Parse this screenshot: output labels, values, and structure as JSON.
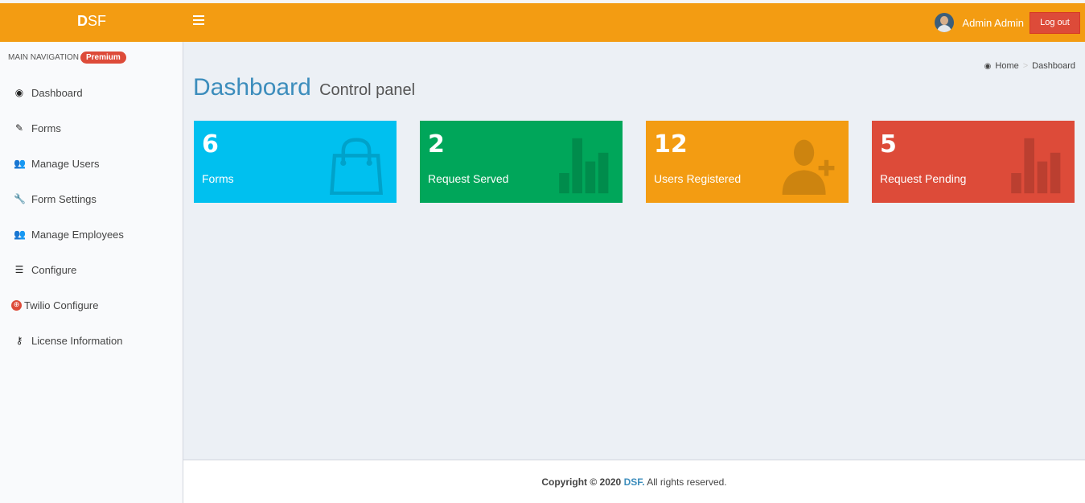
{
  "header": {
    "logo_bold": "D",
    "logo_rest": "SF",
    "user_name": "Admin Admin",
    "logout_label": "Log out"
  },
  "sidebar": {
    "nav_header": "MAIN NAVIGATION",
    "premium_badge": "Premium",
    "items": [
      {
        "label": "Dashboard",
        "icon": "dashboard-icon",
        "glyph": "◉"
      },
      {
        "label": "Forms",
        "icon": "edit-icon",
        "glyph": "✎"
      },
      {
        "label": "Manage Users",
        "icon": "users-icon",
        "glyph": "👥"
      },
      {
        "label": "Form Settings",
        "icon": "wrench-icon",
        "glyph": "🔧"
      },
      {
        "label": "Manage Employees",
        "icon": "users-icon",
        "glyph": "👥"
      },
      {
        "label": "Configure",
        "icon": "sliders-icon",
        "glyph": "☰"
      },
      {
        "label": "Twilio Configure",
        "icon": "twilio-icon",
        "glyph": "⊕"
      },
      {
        "label": "License Information",
        "icon": "key-icon",
        "glyph": "⚷"
      }
    ]
  },
  "breadcrumb": {
    "home": "Home",
    "separator": ">",
    "current": "Dashboard"
  },
  "page": {
    "title": "Dashboard",
    "subtitle": "Control panel"
  },
  "stats": [
    {
      "value": "6",
      "label": "Forms",
      "color": "#00c0ef",
      "icon": "shopping-bag-icon"
    },
    {
      "value": "2",
      "label": "Request Served",
      "color": "#00a65a",
      "icon": "bar-chart-icon"
    },
    {
      "value": "12",
      "label": "Users Registered",
      "color": "#f39c12",
      "icon": "user-plus-icon"
    },
    {
      "value": "5",
      "label": "Request Pending",
      "color": "#dd4b39",
      "icon": "bar-chart-icon"
    }
  ],
  "footer": {
    "copyright_prefix": "Copyright © 2020",
    "brand": "DSF.",
    "suffix": "All rights reserved."
  }
}
